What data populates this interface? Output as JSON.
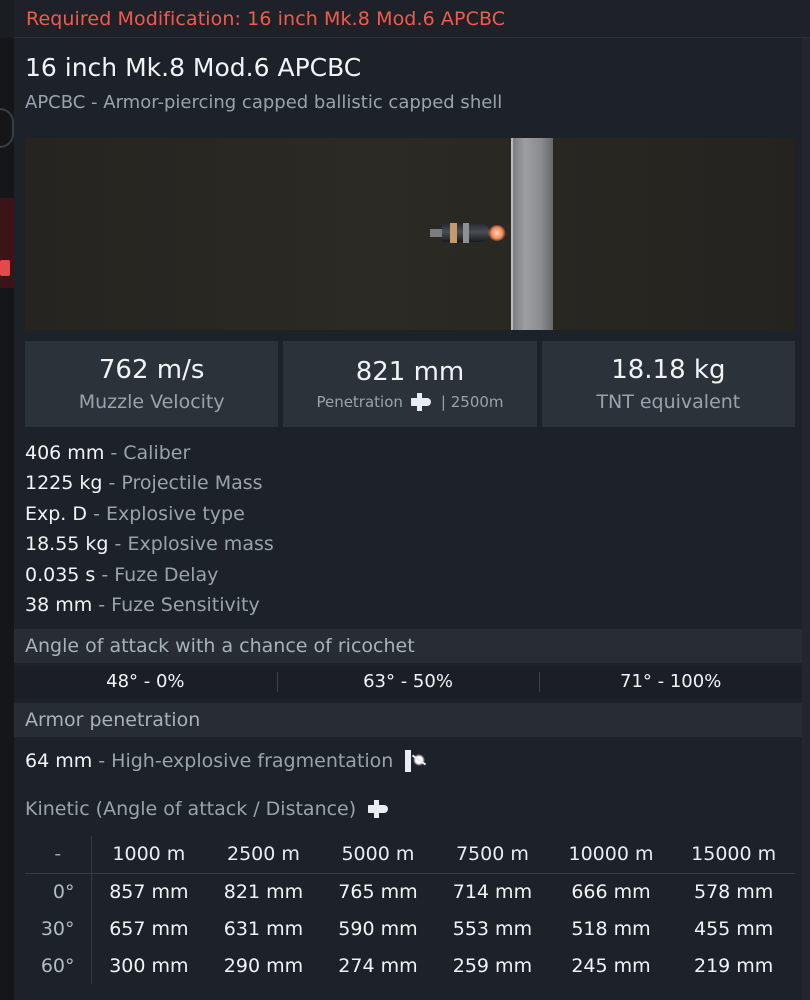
{
  "header": {
    "required_mod": "Required Modification: 16 inch Mk.8 Mod.6 APCBC"
  },
  "shell": {
    "name": "16 inch Mk.8 Mod.6 APCBC",
    "type_desc": "APCBC - Armor-piercing capped ballistic capped shell"
  },
  "stats": {
    "velocity": {
      "value": "762 m/s",
      "label": "Muzzle Velocity"
    },
    "penetration": {
      "value": "821 mm",
      "label": "Penetration",
      "distance": "| 2500m"
    },
    "tnt": {
      "value": "18.18 kg",
      "label": "TNT equivalent"
    }
  },
  "properties": [
    {
      "value": "406 mm",
      "desc": "- Caliber"
    },
    {
      "value": "1225 kg",
      "desc": "- Projectile Mass"
    },
    {
      "value": "Exp. D",
      "desc": "- Explosive type"
    },
    {
      "value": "18.55 kg",
      "desc": "- Explosive mass"
    },
    {
      "value": "0.035 s",
      "desc": "- Fuze Delay"
    },
    {
      "value": "38 mm",
      "desc": "- Fuze Sensitivity"
    }
  ],
  "ricochet": {
    "title": "Angle of attack with a chance of ricochet",
    "cells": [
      "48° - 0%",
      "63° - 50%",
      "71° - 100%"
    ]
  },
  "armor": {
    "title": "Armor penetration",
    "he_value": "64 mm",
    "he_desc": "- High-explosive fragmentation",
    "kinetic_title": "Kinetic (Angle of attack / Distance)"
  },
  "table": {
    "headers": [
      "-",
      "1000 m",
      "2500 m",
      "5000 m",
      "7500 m",
      "10000 m",
      "15000 m"
    ],
    "rows": [
      [
        "0°",
        "857 mm",
        "821 mm",
        "765 mm",
        "714 mm",
        "666 mm",
        "578 mm"
      ],
      [
        "30°",
        "657 mm",
        "631 mm",
        "590 mm",
        "553 mm",
        "518 mm",
        "455 mm"
      ],
      [
        "60°",
        "300 mm",
        "290 mm",
        "274 mm",
        "259 mm",
        "245 mm",
        "219 mm"
      ]
    ]
  },
  "icons": {
    "penetration": "shell-icon",
    "he": "burst-icon",
    "kinetic": "shell-icon"
  }
}
